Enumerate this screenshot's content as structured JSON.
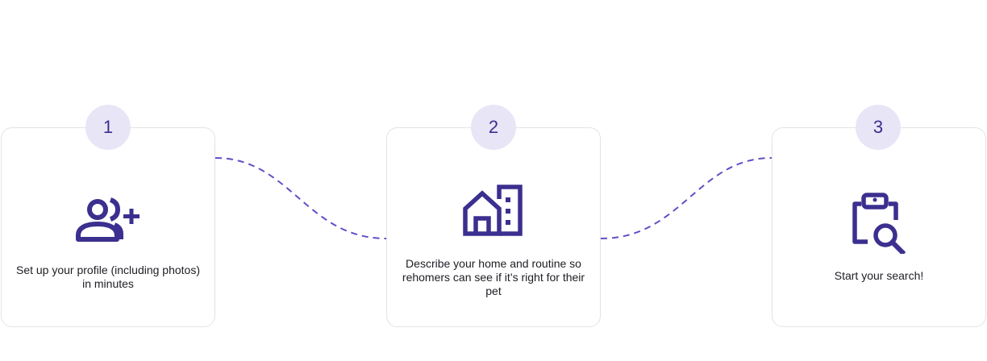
{
  "accent_color": "#3b2f8f",
  "connector_color": "#5e4fc6",
  "badge_background": "#e8e5f6",
  "steps": [
    {
      "number": "1",
      "icon": "user-add-icon",
      "text": "Set up your profile (including photos) in minutes"
    },
    {
      "number": "2",
      "icon": "home-building-icon",
      "text": "Describe your home and routine so rehomers can see if it’s right for their pet"
    },
    {
      "number": "3",
      "icon": "clipboard-search-icon",
      "text": "Start your search!"
    }
  ]
}
